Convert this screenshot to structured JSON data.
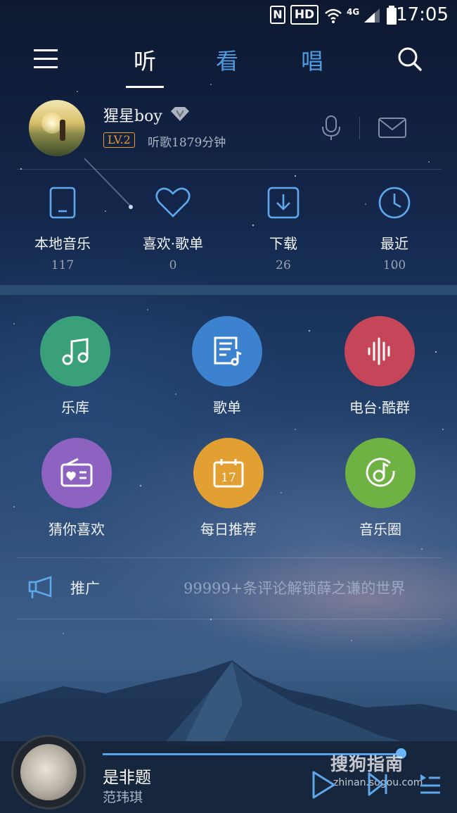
{
  "status_bar": {
    "nfc": "N",
    "hd": "HD",
    "network": "4G",
    "time": "17:05"
  },
  "nav": {
    "tabs": [
      {
        "label": "听",
        "active": true
      },
      {
        "label": "看",
        "active": false
      },
      {
        "label": "唱",
        "active": false
      }
    ]
  },
  "profile": {
    "username": "猩星boy",
    "level": "LV.2",
    "listen_time": "听歌1879分钟"
  },
  "quick_access": [
    {
      "label": "本地音乐",
      "count": "117",
      "icon": "phone-icon"
    },
    {
      "label": "喜欢·歌单",
      "count": "0",
      "icon": "heart-icon"
    },
    {
      "label": "下载",
      "count": "26",
      "icon": "download-icon"
    },
    {
      "label": "最近",
      "count": "100",
      "icon": "clock-icon"
    }
  ],
  "features": [
    {
      "label": "乐库",
      "color": "#3aa07a",
      "icon": "music-note-icon"
    },
    {
      "label": "歌单",
      "color": "#3d82cf",
      "icon": "playlist-icon"
    },
    {
      "label": "电台·酷群",
      "color": "#c44658",
      "icon": "waveform-icon"
    },
    {
      "label": "猜你喜欢",
      "color": "#8e62c0",
      "icon": "radio-icon"
    },
    {
      "label": "每日推荐",
      "color": "#e1a031",
      "icon": "calendar-icon"
    },
    {
      "label": "音乐圈",
      "color": "#6fb244",
      "icon": "music-circle-icon"
    }
  ],
  "calendar_day": "17",
  "promo": {
    "label": "推广",
    "text": "99999+条评论解锁薛之谦的世界"
  },
  "player": {
    "title": "是非题",
    "artist": "范玮琪",
    "progress": 0.98
  },
  "watermark": {
    "cn": "搜狗指南",
    "en": "zhinan.sogou.com"
  }
}
